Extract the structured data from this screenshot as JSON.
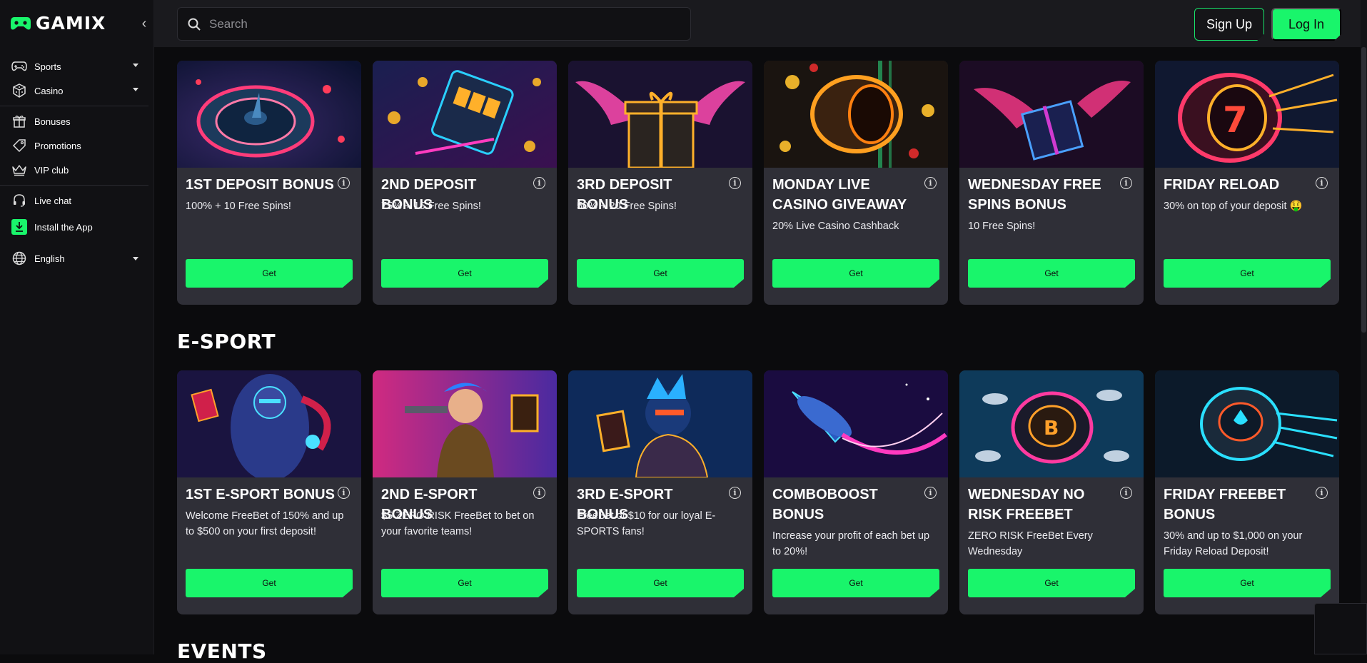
{
  "brand": {
    "name": "GAMIX",
    "accent": "#19f56b"
  },
  "sidebar": {
    "items": [
      {
        "label": "Sports",
        "icon": "gamepad-icon",
        "dropdown": true
      },
      {
        "label": "Casino",
        "icon": "dice-icon",
        "dropdown": true
      },
      {
        "label": "Bonuses",
        "icon": "gift-icon",
        "dropdown": false
      },
      {
        "label": "Promotions",
        "icon": "tag-icon",
        "dropdown": false
      },
      {
        "label": "VIP club",
        "icon": "crown-icon",
        "dropdown": false
      },
      {
        "label": "Live chat",
        "icon": "headset-icon",
        "dropdown": false
      },
      {
        "label": "Install the App",
        "icon": "download-icon",
        "dropdown": false
      },
      {
        "label": "English",
        "icon": "globe-icon",
        "dropdown": true
      }
    ]
  },
  "header": {
    "search_placeholder": "Search",
    "signup_label": "Sign Up",
    "login_label": "Log In"
  },
  "sections": [
    {
      "title": "",
      "cards": [
        {
          "title": "1ST DEPOSIT BONUS",
          "desc": "100% + 10 Free Spins!",
          "button": "Get"
        },
        {
          "title": "2ND DEPOSIT BONUS",
          "desc": "75% + 15 Free Spins!",
          "button": "Get"
        },
        {
          "title": "3RD DEPOSIT BONUS",
          "desc": "50% + 20 Free Spins!",
          "button": "Get"
        },
        {
          "title": "MONDAY LIVE CASINO GIVEAWAY",
          "desc": "20% Live Casino Cashback",
          "button": "Get"
        },
        {
          "title": "WEDNESDAY FREE SPINS BONUS",
          "desc": "10 Free Spins!",
          "button": "Get"
        },
        {
          "title": "FRIDAY RELOAD",
          "desc": "30% on top of your deposit 🤑",
          "button": "Get"
        }
      ]
    },
    {
      "title": "E-SPORT",
      "cards": [
        {
          "title": "1ST E-SPORT BONUS",
          "desc": "Welcome FreeBet of 150% and up to $500 on your first deposit!",
          "button": "Get"
        },
        {
          "title": "2ND E-SPORT BONUS",
          "desc": "$5 ZERO RISK FreeBet to bet on your favorite teams!",
          "button": "Get"
        },
        {
          "title": "3RD E-SPORT BONUS",
          "desc": "FreeBet of $10 for our loyal E-SPORTS fans!",
          "button": "Get"
        },
        {
          "title": "COMBOBOOST BONUS",
          "desc": "Increase your profit of each bet up to 20%!",
          "button": "Get"
        },
        {
          "title": "WEDNESDAY NO RISK FREEBET",
          "desc": "ZERO RISK FreeBet Every Wednesday",
          "button": "Get"
        },
        {
          "title": "FRIDAY FREEBET BONUS",
          "desc": "30% and up to $1,000 on your Friday Reload Deposit!",
          "button": "Get"
        }
      ]
    },
    {
      "title": "EVENTS",
      "cards": []
    }
  ]
}
